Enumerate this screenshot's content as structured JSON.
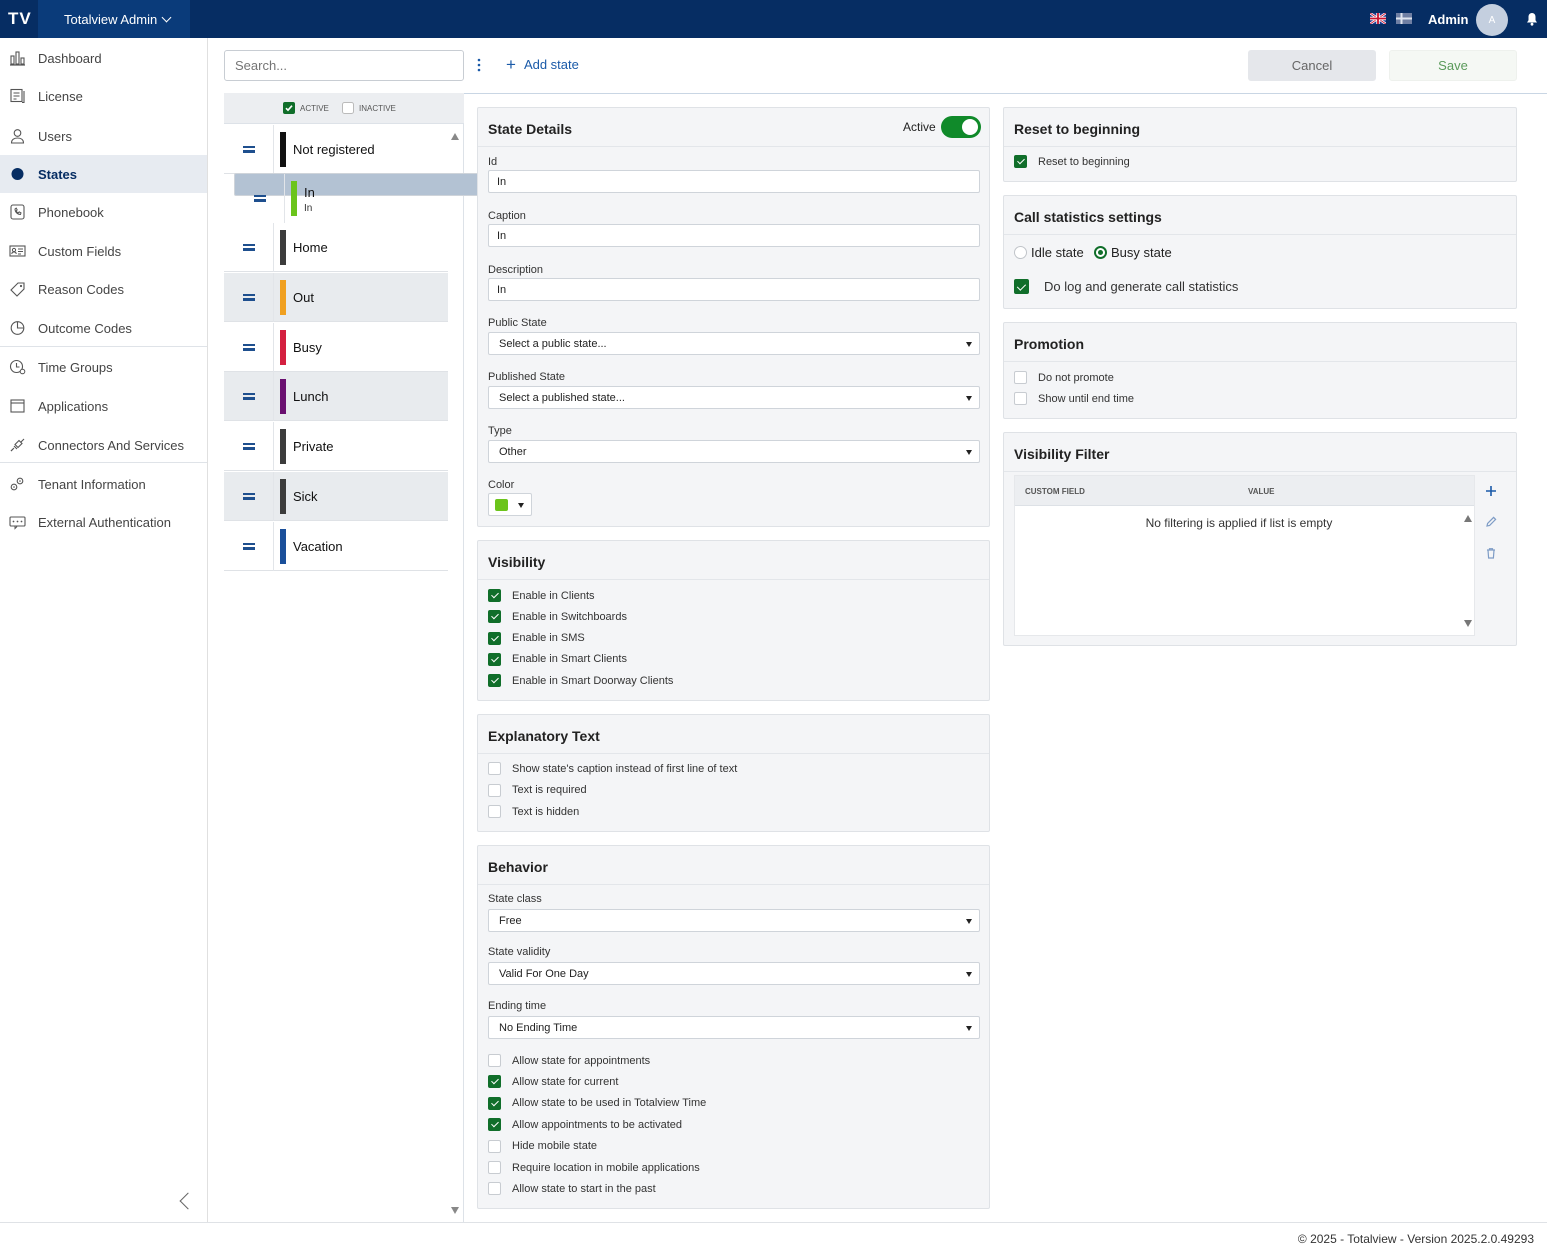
{
  "topbar": {
    "logo": "TV",
    "app_name": "Totalview Admin",
    "user_name": "Admin",
    "avatar_initial": "A"
  },
  "sidebar": {
    "items": [
      {
        "label": "Dashboard",
        "icon": "bar-chart-icon"
      },
      {
        "label": "License",
        "icon": "license-icon"
      },
      {
        "label": "Users",
        "icon": "user-icon"
      },
      {
        "label": "States",
        "icon": "state-dot-icon",
        "active": true
      },
      {
        "label": "Phonebook",
        "icon": "phone-icon"
      },
      {
        "label": "Custom Fields",
        "icon": "id-card-icon"
      },
      {
        "label": "Reason Codes",
        "icon": "tag-icon"
      },
      {
        "label": "Outcome Codes",
        "icon": "pie-icon"
      },
      {
        "label": "Time Groups",
        "icon": "clock-user-icon"
      },
      {
        "label": "Applications",
        "icon": "window-icon"
      },
      {
        "label": "Connectors And Services",
        "icon": "plug-icon"
      },
      {
        "label": "Tenant Information",
        "icon": "gears-icon"
      },
      {
        "label": "External Authentication",
        "icon": "password-icon"
      }
    ]
  },
  "toolbar": {
    "search_placeholder": "Search...",
    "add_state_label": "Add state",
    "cancel_label": "Cancel",
    "save_label": "Save"
  },
  "state_list": {
    "filter_active": "ACTIVE",
    "filter_inactive": "INACTIVE",
    "states": [
      {
        "name": "Not registered",
        "color": "#111111"
      },
      {
        "name": "In",
        "sub": "In",
        "color": "#6bc41b",
        "selected": true
      },
      {
        "name": "Home",
        "color": "#3c3c3c"
      },
      {
        "name": "Out",
        "color": "#f0a020"
      },
      {
        "name": "Busy",
        "color": "#d42040"
      },
      {
        "name": "Lunch",
        "color": "#6a1070"
      },
      {
        "name": "Private",
        "color": "#3c3c3c"
      },
      {
        "name": "Sick",
        "color": "#3c3c3c"
      },
      {
        "name": "Vacation",
        "color": "#1a4f9a"
      }
    ]
  },
  "state_details": {
    "title": "State Details",
    "active_label": "Active",
    "id_label": "Id",
    "id_value": "In",
    "caption_label": "Caption",
    "caption_value": "In",
    "description_label": "Description",
    "description_value": "In",
    "public_state_label": "Public State",
    "public_state_value": "Select a public state...",
    "published_state_label": "Published State",
    "published_state_value": "Select a published state...",
    "type_label": "Type",
    "type_value": "Other",
    "color_label": "Color",
    "color_value": "#6bc41b"
  },
  "visibility": {
    "title": "Visibility",
    "options": [
      {
        "label": "Enable in Clients",
        "checked": true
      },
      {
        "label": "Enable in Switchboards",
        "checked": true
      },
      {
        "label": "Enable in SMS",
        "checked": true
      },
      {
        "label": "Enable in Smart Clients",
        "checked": true
      },
      {
        "label": "Enable in Smart Doorway Clients",
        "checked": true
      }
    ]
  },
  "explanatory": {
    "title": "Explanatory Text",
    "options": [
      {
        "label": "Show state's caption instead of first line of text",
        "checked": false
      },
      {
        "label": "Text is required",
        "checked": false
      },
      {
        "label": "Text is hidden",
        "checked": false
      }
    ]
  },
  "behavior": {
    "title": "Behavior",
    "state_class_label": "State class",
    "state_class_value": "Free",
    "state_validity_label": "State validity",
    "state_validity_value": "Valid For One Day",
    "ending_time_label": "Ending time",
    "ending_time_value": "No Ending Time",
    "options": [
      {
        "label": "Allow state for appointments",
        "checked": false
      },
      {
        "label": "Allow state for current",
        "checked": true
      },
      {
        "label": "Allow state to be used in Totalview Time",
        "checked": true
      },
      {
        "label": "Allow appointments to be activated",
        "checked": true
      },
      {
        "label": "Hide mobile state",
        "checked": false
      },
      {
        "label": "Require location in mobile applications",
        "checked": false
      },
      {
        "label": "Allow state to start in the past",
        "checked": false
      }
    ]
  },
  "reset": {
    "title": "Reset to beginning",
    "option_label": "Reset to beginning",
    "checked": true
  },
  "call_stats": {
    "title": "Call statistics settings",
    "idle_label": "Idle state",
    "busy_label": "Busy state",
    "selected": "busy",
    "log_label": "Do log and generate call statistics",
    "log_checked": true
  },
  "promotion": {
    "title": "Promotion",
    "options": [
      {
        "label": "Do not promote",
        "checked": false
      },
      {
        "label": "Show until end time",
        "checked": false
      }
    ]
  },
  "visibility_filter": {
    "title": "Visibility Filter",
    "col_custom_field": "CUSTOM FIELD",
    "col_value": "VALUE",
    "empty_text": "No filtering is applied if list is empty"
  },
  "footer": {
    "text": "© 2025 - Totalview - Version 2025.2.0.49293"
  }
}
